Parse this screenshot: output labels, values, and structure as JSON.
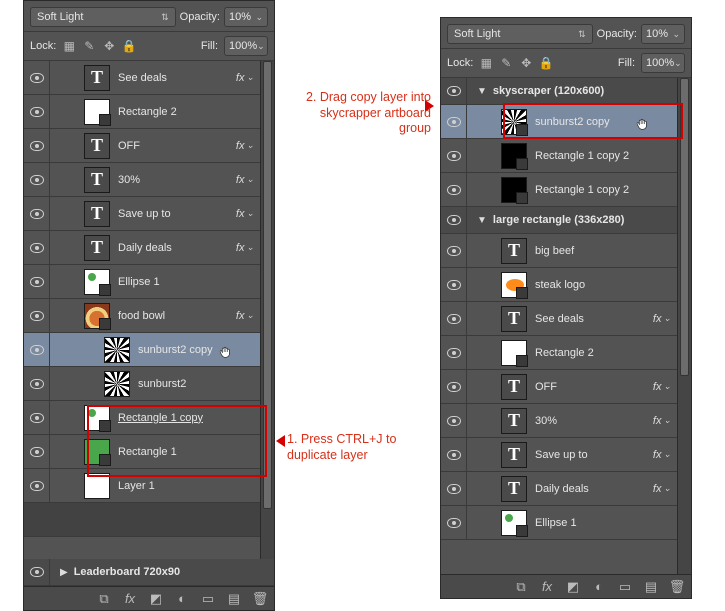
{
  "blendmode": {
    "label": "Soft Light"
  },
  "opacity": {
    "label": "Opacity:",
    "value": "10%"
  },
  "fill": {
    "label": "Fill:",
    "value": "100%"
  },
  "lock": {
    "label": "Lock:"
  },
  "annot1": "1. Press CTRL+J to duplicate layer",
  "annot2": "2. Drag copy layer into skycrapper artboard group",
  "left": {
    "layers": [
      {
        "name": "See deals",
        "icon": "type",
        "fx": true
      },
      {
        "name": "Rectangle 2",
        "icon": "white",
        "badge": true
      },
      {
        "name": "OFF",
        "icon": "type",
        "fx": true
      },
      {
        "name": "30%",
        "icon": "type",
        "fx": true
      },
      {
        "name": "Save up to",
        "icon": "type",
        "fx": true
      },
      {
        "name": "Daily deals",
        "icon": "type",
        "fx": true
      },
      {
        "name": "Ellipse 1",
        "icon": "whitegreen",
        "badge": true
      },
      {
        "name": "food bowl",
        "icon": "bowl",
        "badge": true,
        "fx": true
      },
      {
        "name": "sunburst2 copy",
        "icon": "sun",
        "selected": true,
        "indent": 2,
        "cursor": true
      },
      {
        "name": "sunburst2",
        "icon": "sun",
        "indent": 2
      },
      {
        "name": "Rectangle 1 copy",
        "icon": "greenmark",
        "badge": true,
        "underline": true
      },
      {
        "name": "Rectangle 1",
        "icon": "green",
        "badge": true
      },
      {
        "name": "Layer 1",
        "icon": "white"
      }
    ],
    "footerGroup": "Leaderboard 720x90"
  },
  "right": {
    "group1": "skyscraper (120x600)",
    "group1layers": [
      {
        "name": "sunburst2 copy",
        "icon": "sun",
        "badge": true,
        "selected": true,
        "cursor": true
      },
      {
        "name": "Rectangle 1 copy 2",
        "icon": "black",
        "badge": true
      },
      {
        "name": "Rectangle 1 copy 2",
        "icon": "black",
        "badge": true
      }
    ],
    "group2": "large rectangle (336x280)",
    "group2layers": [
      {
        "name": "big beef",
        "icon": "type"
      },
      {
        "name": "steak logo",
        "icon": "steak",
        "badge": true
      },
      {
        "name": "See deals",
        "icon": "type",
        "fx": true
      },
      {
        "name": "Rectangle 2",
        "icon": "white",
        "badge": true
      },
      {
        "name": "OFF",
        "icon": "type",
        "fx": true
      },
      {
        "name": "30%",
        "icon": "type",
        "fx": true
      },
      {
        "name": "Save up to",
        "icon": "type",
        "fx": true
      },
      {
        "name": "Daily deals",
        "icon": "type",
        "fx": true
      },
      {
        "name": "Ellipse 1",
        "icon": "whitegreen",
        "badge": true
      }
    ]
  }
}
